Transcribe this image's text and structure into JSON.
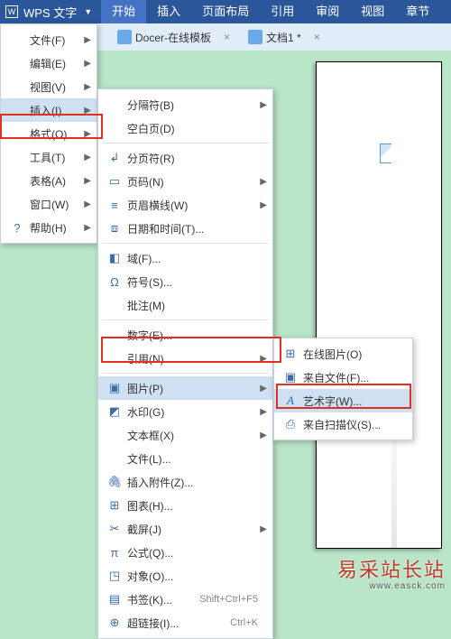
{
  "app": {
    "name": "WPS 文字"
  },
  "ribbon": [
    "开始",
    "插入",
    "页面布局",
    "引用",
    "审阅",
    "视图",
    "章节"
  ],
  "docrow": {
    "tab1": "Docer-在线模板",
    "tab2": "文档1 *"
  },
  "menu1": [
    {
      "label": "文件(F)",
      "arrow": true
    },
    {
      "label": "编辑(E)",
      "arrow": true
    },
    {
      "label": "视图(V)",
      "arrow": true
    },
    {
      "label": "插入(I)",
      "arrow": true,
      "active": true
    },
    {
      "label": "格式(O)",
      "arrow": true
    },
    {
      "label": "工具(T)",
      "arrow": true
    },
    {
      "label": "表格(A)",
      "arrow": true
    },
    {
      "label": "窗口(W)",
      "arrow": true
    },
    {
      "label": "帮助(H)",
      "arrow": true,
      "icon": "?"
    }
  ],
  "menu2": [
    {
      "icon": "",
      "label": "分隔符(B)",
      "arrow": true
    },
    {
      "icon": "",
      "label": "空白页(D)"
    },
    {
      "sep": true
    },
    {
      "icon": "↲",
      "label": "分页符(R)"
    },
    {
      "icon": "▭",
      "label": "页码(N)",
      "arrow": true
    },
    {
      "icon": "≡",
      "label": "页眉横线(W)",
      "arrow": true
    },
    {
      "icon": "⧈",
      "label": "日期和时间(T)..."
    },
    {
      "sep": true
    },
    {
      "icon": "◧",
      "label": "域(F)..."
    },
    {
      "icon": "Ω",
      "label": "符号(S)..."
    },
    {
      "icon": "",
      "label": "批注(M)"
    },
    {
      "sep": true
    },
    {
      "icon": "",
      "label": "数字(E)..."
    },
    {
      "icon": "",
      "label": "引用(N)",
      "arrow": true
    },
    {
      "sep": true
    },
    {
      "icon": "▣",
      "label": "图片(P)",
      "arrow": true,
      "active": true
    },
    {
      "icon": "◩",
      "label": "水印(G)",
      "arrow": true
    },
    {
      "icon": "",
      "label": "文本框(X)",
      "arrow": true
    },
    {
      "icon": "",
      "label": "文件(L)..."
    },
    {
      "icon": "🖇",
      "label": "插入附件(Z)..."
    },
    {
      "icon": "⊞",
      "label": "图表(H)..."
    },
    {
      "icon": "✂",
      "label": "截屏(J)",
      "arrow": true
    },
    {
      "icon": "π",
      "label": "公式(Q)..."
    },
    {
      "icon": "◳",
      "label": "对象(O)..."
    },
    {
      "icon": "▤",
      "label": "书签(K)...",
      "shortcut": "Shift+Ctrl+F5"
    },
    {
      "icon": "⊕",
      "label": "超链接(I)...",
      "shortcut": "Ctrl+K"
    }
  ],
  "menu3": [
    {
      "icon": "⊞",
      "label": "在线图片(O)"
    },
    {
      "icon": "▣",
      "label": "来自文件(F)..."
    },
    {
      "icon": "A",
      "label": "艺术字(W)...",
      "active": true,
      "blue": true
    },
    {
      "icon": "⎙",
      "label": "来自扫描仪(S)..."
    }
  ],
  "watermark": {
    "cn": "易采站长站",
    "en": "www.easck.com"
  }
}
